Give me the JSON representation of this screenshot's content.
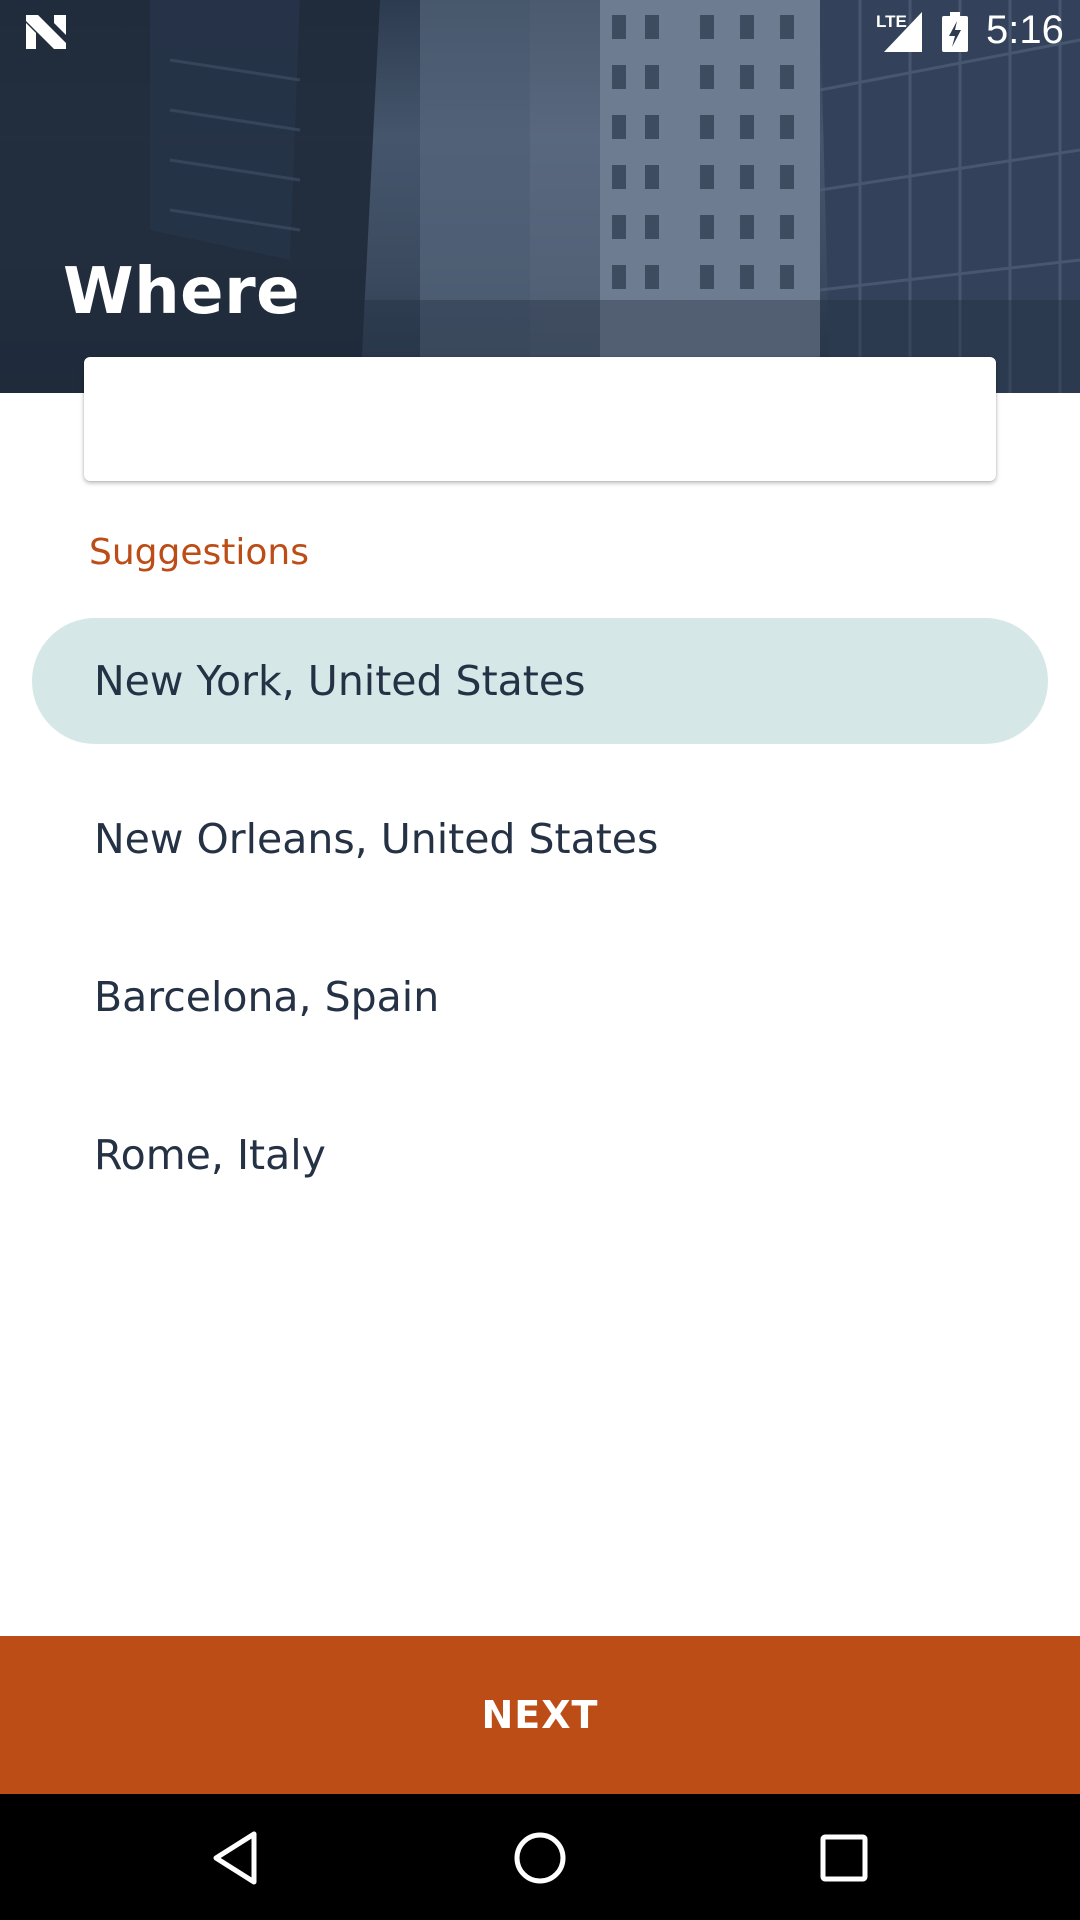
{
  "status_bar": {
    "network_type": "LTE",
    "time": "5:16",
    "icons": [
      "n-logo-icon",
      "signal-icon",
      "battery-charging-icon"
    ]
  },
  "header": {
    "title": "Where"
  },
  "search": {
    "value": "",
    "placeholder": ""
  },
  "suggestions": {
    "label": "Suggestions",
    "items": [
      {
        "label": "New York, United States",
        "selected": true
      },
      {
        "label": "New Orleans, United States",
        "selected": false
      },
      {
        "label": "Barcelona, Spain",
        "selected": false
      },
      {
        "label": "Rome, Italy",
        "selected": false
      }
    ]
  },
  "footer": {
    "next_label": "NEXT"
  },
  "navigation": {
    "icons": [
      "back-icon",
      "home-icon",
      "recents-icon"
    ]
  },
  "colors": {
    "accent": "#bd4d17",
    "selected_row": "#d5e7e6",
    "text": "#253245",
    "header_overlay": "#2d3b4f"
  }
}
